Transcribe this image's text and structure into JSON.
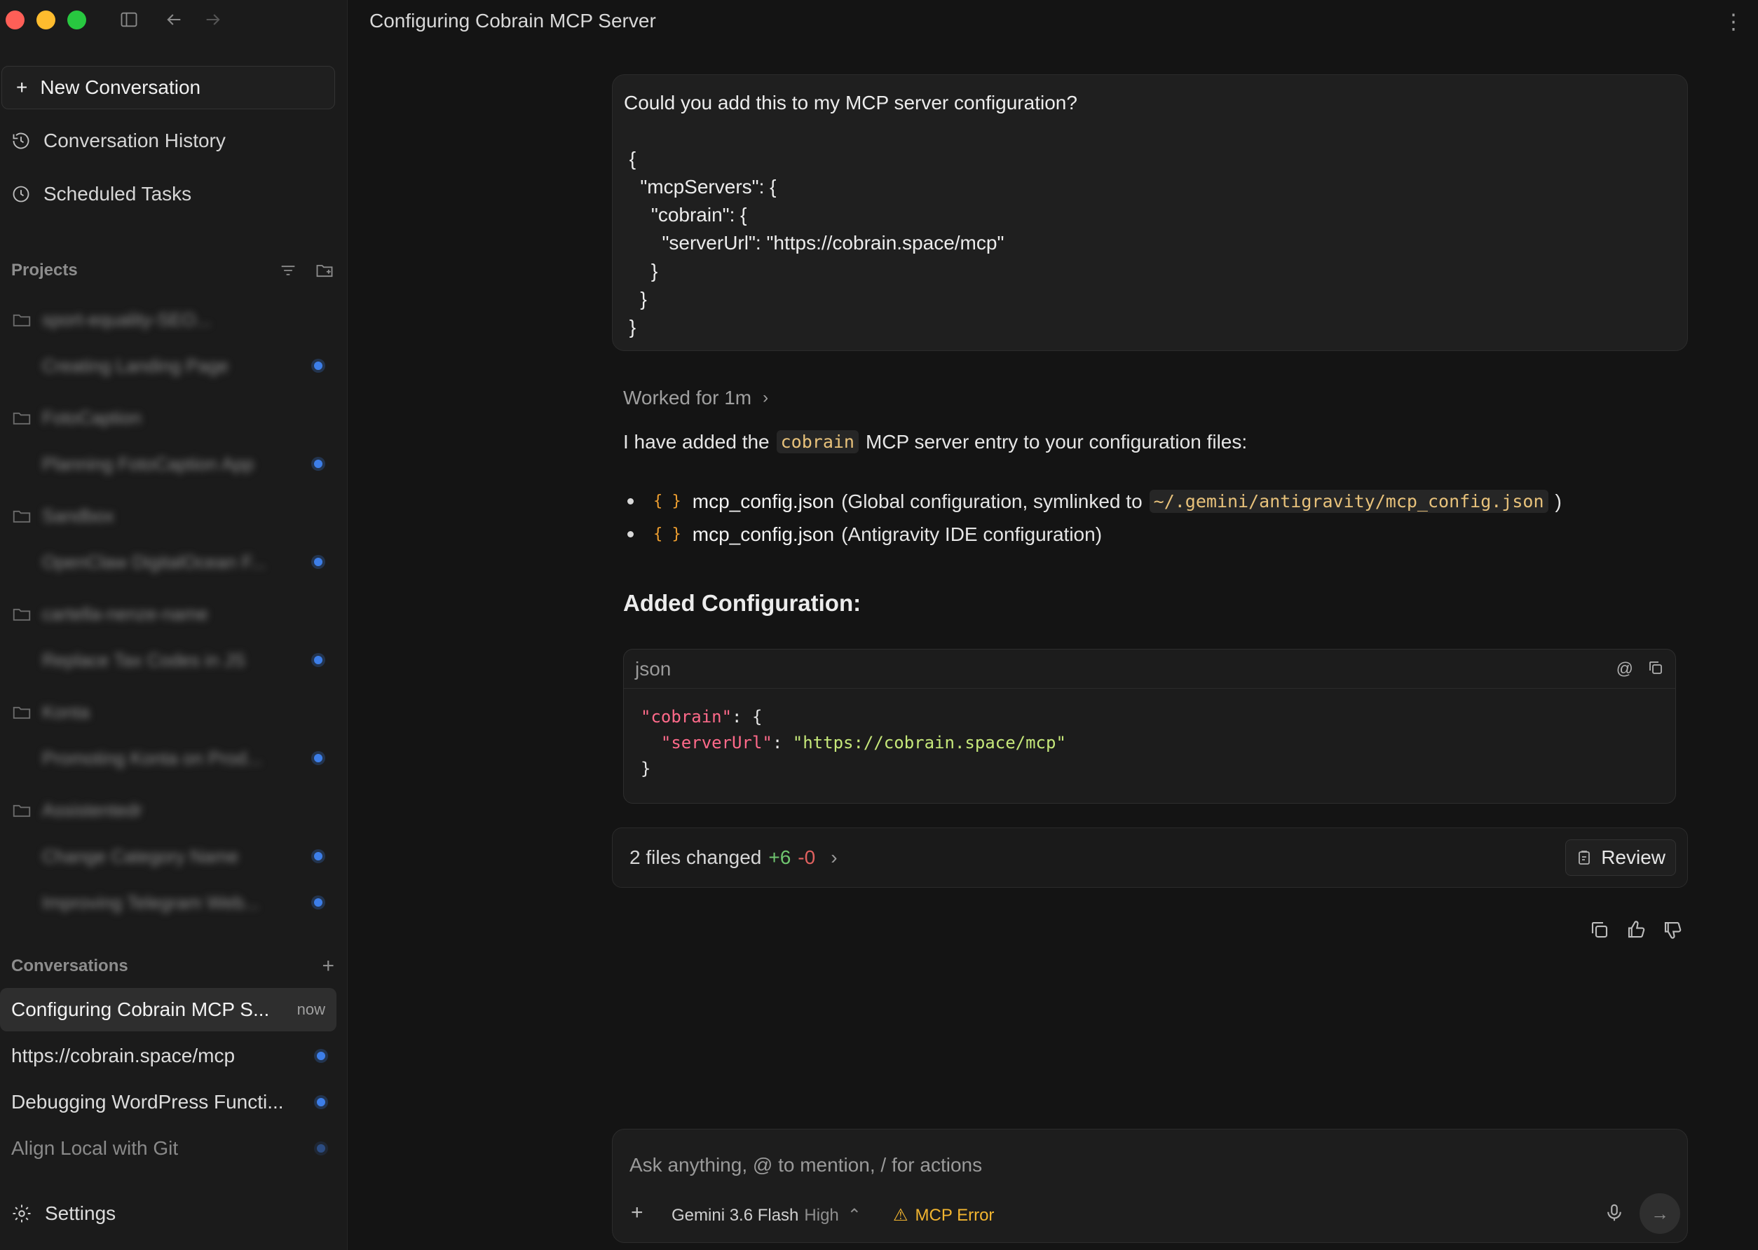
{
  "window": {
    "title": "Configuring Cobrain MCP Server"
  },
  "sidebar": {
    "new_conversation": "New Conversation",
    "nav": [
      {
        "label": "Conversation History",
        "icon": "history-icon"
      },
      {
        "label": "Scheduled Tasks",
        "icon": "clock-icon"
      }
    ],
    "projects_heading": "Projects",
    "projects": [
      {
        "name": "sport-equality-SEO...",
        "conversations": [
          "Creating Landing Page"
        ]
      },
      {
        "name": "FotoCaption",
        "conversations": [
          "Planning FotoCaption App"
        ]
      },
      {
        "name": "Sandbox",
        "conversations": [
          "OpenClaw DigitalOcean F..."
        ]
      },
      {
        "name": "cartella-nenze-name",
        "conversations": [
          "Replace Tax Codes in JS"
        ]
      },
      {
        "name": "Konta",
        "conversations": [
          "Promoting Konta on Prod..."
        ]
      },
      {
        "name": "Assistentedr",
        "conversations": [
          "Change Category Name",
          "Improving Telegram Web..."
        ]
      }
    ],
    "conversations_heading": "Conversations",
    "conversations": [
      {
        "title": "Configuring Cobrain MCP S...",
        "time": "now",
        "active": true
      },
      {
        "title": "https://cobrain.space/mcp",
        "unread": true
      },
      {
        "title": "Debugging WordPress Functi...",
        "unread": true
      },
      {
        "title": "Align Local with Git",
        "unread": true
      }
    ],
    "settings": "Settings"
  },
  "chat": {
    "user_message": "Could you add this to my MCP server configuration?\n\n {\n   \"mcpServers\": {\n     \"cobrain\": {\n       \"serverUrl\": \"https://cobrain.space/mcp\"\n     }\n   }\n }",
    "worked_for": "Worked for 1m",
    "answer_intro_before": "I have added the",
    "answer_intro_code": "cobrain",
    "answer_intro_after": "MCP server entry to your configuration files:",
    "files": [
      {
        "name": "mcp_config.json",
        "desc_before": "(Global configuration, symlinked to",
        "path": "~/.gemini/antigravity/mcp_config.json",
        "desc_after": ")"
      },
      {
        "name": "mcp_config.json",
        "desc_before": "(Antigravity IDE configuration)",
        "path": "",
        "desc_after": ""
      }
    ],
    "added_heading": "Added Configuration:",
    "code_block": {
      "language": "json",
      "line1_key": "\"cobrain\"",
      "line1_rest": ": {",
      "line2_key": "\"serverUrl\"",
      "line2_sep": ": ",
      "line2_value": "\"https://cobrain.space/mcp\"",
      "line3": "}"
    },
    "files_changed": "2 files changed",
    "additions": "+6",
    "deletions": "-0",
    "review": "Review"
  },
  "composer": {
    "placeholder": "Ask anything, @ to mention, / for actions",
    "model": "Gemini 3.6 Flash",
    "level": "High",
    "mcp_status": "MCP Error"
  }
}
